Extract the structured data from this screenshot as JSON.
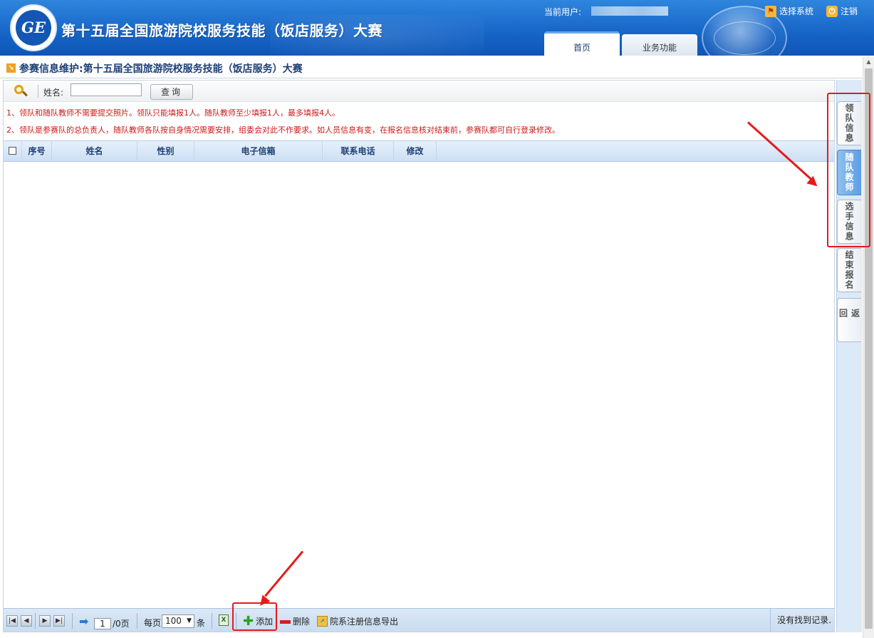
{
  "header": {
    "logo_text": "GE",
    "site_title": "第十五届全国旅游院校服务技能（饭店服务）大赛",
    "current_user_label": "当前用户:",
    "select_system_label": "选择系统",
    "logout_label": "注销",
    "tabs": [
      {
        "label": "首页",
        "active": true
      },
      {
        "label": "业务功能",
        "active": false
      }
    ]
  },
  "breadcrumb": {
    "text": "参赛信息维护:第十五届全国旅游院校服务技能（饭店服务）大赛"
  },
  "search": {
    "name_label": "姓名:",
    "name_value": "",
    "query_button_label": "查询"
  },
  "notices": [
    "1、领队和随队教师不需要提交照片。领队只能填报1人。随队教师至少填报1人，最多填报4人。",
    "2、领队是参赛队的总负责人，随队教师各队按自身情况需要安排，组委会对此不作要求。如人员信息有变，在报名信息核对结束前，参赛队都可自行登录修改。"
  ],
  "grid": {
    "columns": [
      "序号",
      "姓名",
      "性别",
      "电子信箱",
      "联系电话",
      "修改"
    ],
    "rows": []
  },
  "pager": {
    "current_page": "1",
    "total_pages_text": "/0页",
    "per_page_label": "每页",
    "per_page_value": "100",
    "per_page_unit": "条",
    "add_label": "添加",
    "delete_label": "删除",
    "export_label": "院系注册信息导出",
    "status_text": "没有找到记录."
  },
  "side_tabs": [
    {
      "label": "领队信息",
      "active": false
    },
    {
      "label": "随队教师",
      "active": true
    },
    {
      "label": "选手信息",
      "active": false
    },
    {
      "label": "结束报名",
      "active": false
    },
    {
      "label": "返回",
      "active": false
    }
  ],
  "colors": {
    "header_blue": "#1664c7",
    "notice_red": "#d01818",
    "annotation_red": "#e41b1b",
    "active_tab_blue": "#5b9ee6"
  }
}
